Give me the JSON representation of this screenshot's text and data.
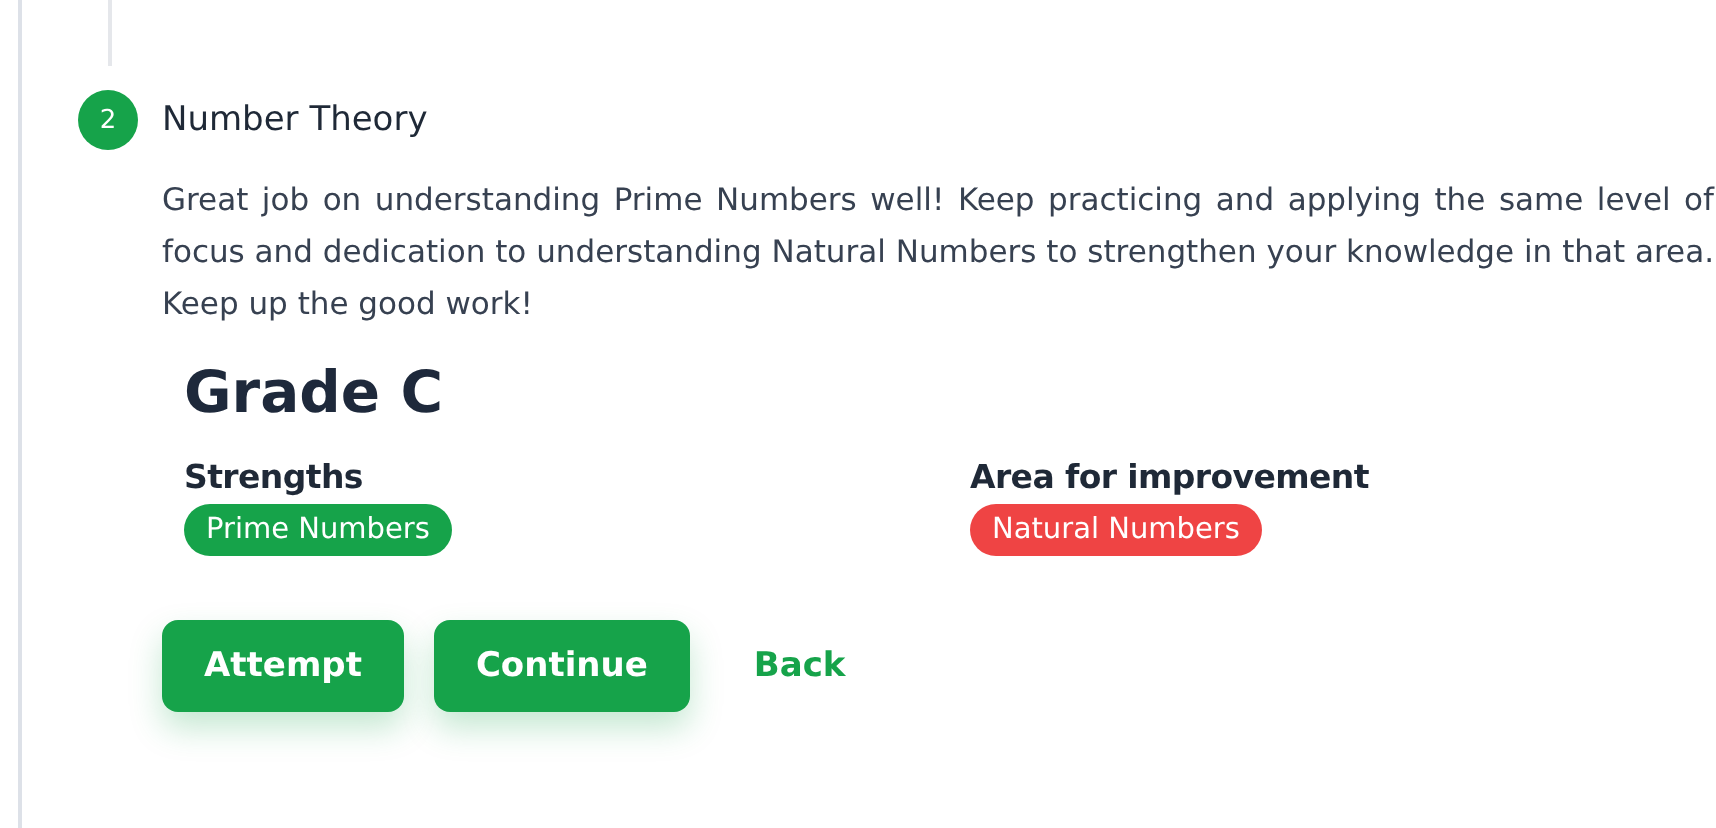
{
  "step": {
    "number": "2",
    "title": "Number Theory",
    "feedback": "Great job on understanding Prime Numbers well! Keep practicing and applying the same level of focus and dedication to understanding Natural Numbers to strengthen your knowledge in that area. Keep up the good work!"
  },
  "grade": "Grade C",
  "groups": [
    {
      "heading": "Strengths",
      "tags": [
        {
          "label": "Prime Numbers",
          "color": "#16a34a"
        }
      ]
    },
    {
      "heading": "Area for improvement",
      "tags": [
        {
          "label": "Natural Numbers",
          "color": "#ef4444"
        }
      ]
    }
  ],
  "buttons": [
    {
      "label": "Attempt",
      "kind": "primary"
    },
    {
      "label": "Continue",
      "kind": "primary"
    },
    {
      "label": "Back",
      "kind": "link"
    }
  ]
}
